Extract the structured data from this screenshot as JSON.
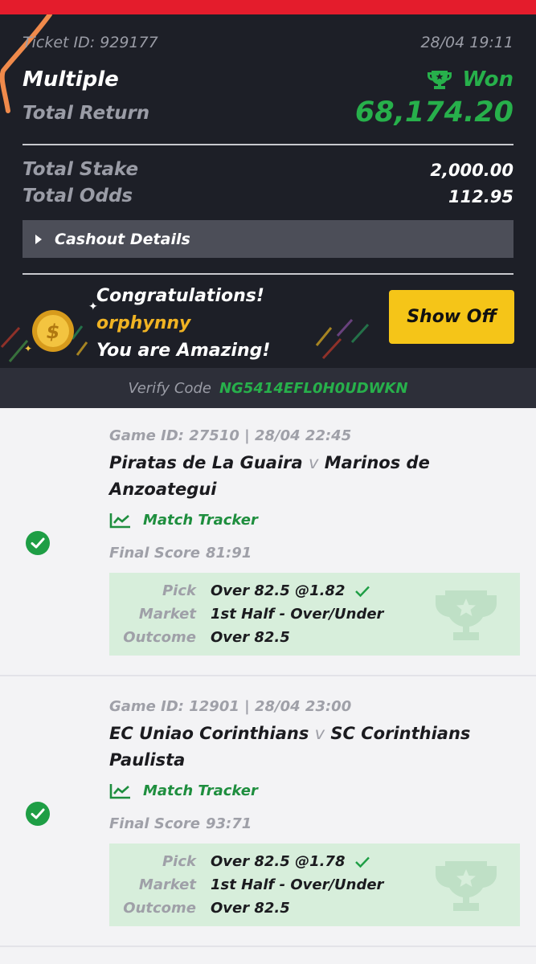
{
  "ticket": {
    "id_text": "Ticket ID: 929177",
    "date": "28/04 19:11",
    "bet_type": "Multiple",
    "status": "Won",
    "total_return_label": "Total Return",
    "total_return": "68,174.20",
    "total_stake_label": "Total Stake",
    "total_stake": "2,000.00",
    "total_odds_label": "Total Odds",
    "total_odds": "112.95",
    "cashout_label": "Cashout Details"
  },
  "promo": {
    "line1": "Congratulations!",
    "username": "orphynny",
    "line3": "You are Amazing!",
    "button": "Show Off"
  },
  "verify": {
    "label": "Verify Code",
    "code": "NG5414EFL0H0UDWKN"
  },
  "games": [
    {
      "meta": "Game ID: 27510 | 28/04 22:45",
      "home": "Piratas de La Guaira",
      "vs": "v",
      "away": "Marinos de Anzoategui",
      "tracker": "Match Tracker",
      "score_label": "Final Score",
      "score": "81:91",
      "pick_label": "Pick",
      "pick": "Over 82.5 @1.82",
      "market_label": "Market",
      "market": "1st Half - Over/Under",
      "outcome_label": "Outcome",
      "outcome": "Over 82.5"
    },
    {
      "meta": "Game ID: 12901 | 28/04 23:00",
      "home": "EC Uniao Corinthians",
      "vs": "v",
      "away": "SC Corinthians Paulista",
      "tracker": "Match Tracker",
      "score_label": "Final Score",
      "score": "93:71",
      "pick_label": "Pick",
      "pick": "Over 82.5 @1.78",
      "market_label": "Market",
      "market": "1st Half - Over/Under",
      "outcome_label": "Outcome",
      "outcome": "Over 82.5"
    }
  ],
  "colors": {
    "accent_red": "#e41c2c",
    "won_green": "#27b04b",
    "header_bg": "#1d1f27",
    "button_yellow": "#f5c518",
    "pick_bg": "#d7eedb"
  },
  "icons": [
    "trophy-icon",
    "caret-right-icon",
    "coin-icon",
    "chart-icon",
    "check-circle-icon",
    "checkmark-icon",
    "trophy-watermark-icon"
  ]
}
